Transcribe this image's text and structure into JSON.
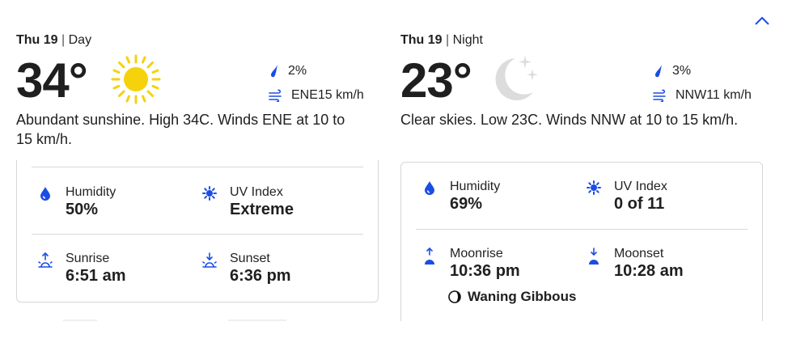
{
  "collapse": {
    "icon": "chevron-up-icon"
  },
  "day": {
    "date": "Thu 19",
    "separator": "|",
    "period": "Day",
    "temperature": "34°",
    "weather_icon": "sun-icon",
    "precip": "2%",
    "wind": "ENE15 km/h",
    "summary": "Abundant sunshine. High 34C. Winds ENE at 10 to 15 km/h.",
    "details": {
      "humidity_label": "Humidity",
      "humidity_value": "50%",
      "uv_label": "UV Index",
      "uv_value": "Extreme",
      "sunrise_label": "Sunrise",
      "sunrise_value": "6:51 am",
      "sunset_label": "Sunset",
      "sunset_value": "6:36 pm"
    }
  },
  "night": {
    "date": "Thu 19",
    "separator": "|",
    "period": "Night",
    "temperature": "23°",
    "weather_icon": "moon-stars-icon",
    "precip": "3%",
    "wind": "NNW11 km/h",
    "summary": "Clear skies. Low 23C. Winds NNW at 10 to 15 km/h.",
    "details": {
      "humidity_label": "Humidity",
      "humidity_value": "69%",
      "uv_label": "UV Index",
      "uv_value": "0 of 11",
      "moonrise_label": "Moonrise",
      "moonrise_value": "10:36 pm",
      "moonset_label": "Moonset",
      "moonset_value": "10:28 am",
      "moon_phase": "Waning Gibbous"
    }
  },
  "colors": {
    "accent": "#1b4de4",
    "sun": "#f5d20b",
    "moon": "#dcdcdc"
  }
}
